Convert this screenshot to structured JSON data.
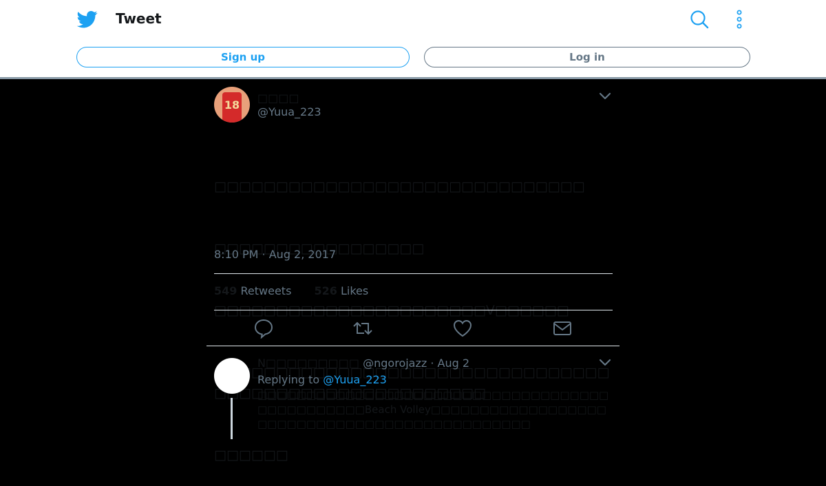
{
  "header": {
    "title": "Tweet",
    "signup_label": "Sign up",
    "login_label": "Log in",
    "logo_icon": "twitter-bird-icon",
    "search_icon": "search-icon",
    "more_icon": "more-vertical-icon"
  },
  "tweet": {
    "name": "□□□□",
    "handle": "@Yuua_223",
    "lines": [
      "□□□□□□□□□□□□□□□□□□□□□□□□□□□□□□",
      "□□□□□□□□□□□□□□□□□",
      "□□□□□□□□□□□□□□□□□□□□□□V□□□□□□",
      "□□□□□□□□□□□□□□□□□□□□□□□□□□□□□□□□□□□□□□□□□□□□□□□□□□□□□□",
      "□□□□□□"
    ],
    "timestamp": "8:10 PM · Aug 2, 2017",
    "retweets_count": "549",
    "retweets_label": "Retweets",
    "likes_count": "526",
    "likes_label": "Likes"
  },
  "reply": {
    "name": "N□□□□□□□□□",
    "handle": "@ngorojazz",
    "date": "· Aug 2",
    "replying_prefix": "Replying to",
    "replying_to": "@Yuua_223",
    "text": "□□□□□□□□□□□□□□□□□□□□□□□□□□□□□□□□□□□□□□□□□□□□□□□Beach Volley□□□□□□□□□□□□□□□□□□□□□□□□□□□□□□□□□□□□□□□□□□□□□□"
  },
  "colors": {
    "brand": "#1da1f2",
    "text_primary": "#14171a",
    "text_secondary": "#657786"
  }
}
